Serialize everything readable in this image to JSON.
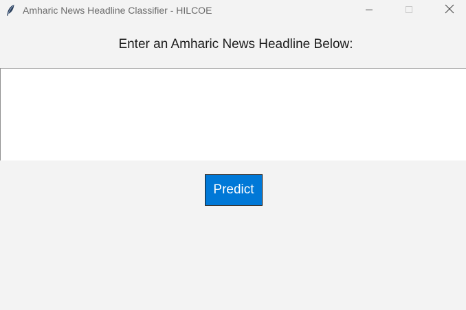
{
  "window": {
    "title": "Amharic News Headline Classifier - HILCOE",
    "icon": "feather-icon",
    "controls": [
      "minimize-icon",
      "maximize-icon",
      "close-icon"
    ]
  },
  "main": {
    "prompt": "Enter an Amharic News Headline Below:",
    "headline_value": "",
    "predict_label": "Predict"
  },
  "colors": {
    "background": "#f3f3f3",
    "input_background": "#ffffff",
    "button_accent": "#0078d7",
    "button_text": "#ffffff",
    "title_text": "#6b6b6b"
  }
}
